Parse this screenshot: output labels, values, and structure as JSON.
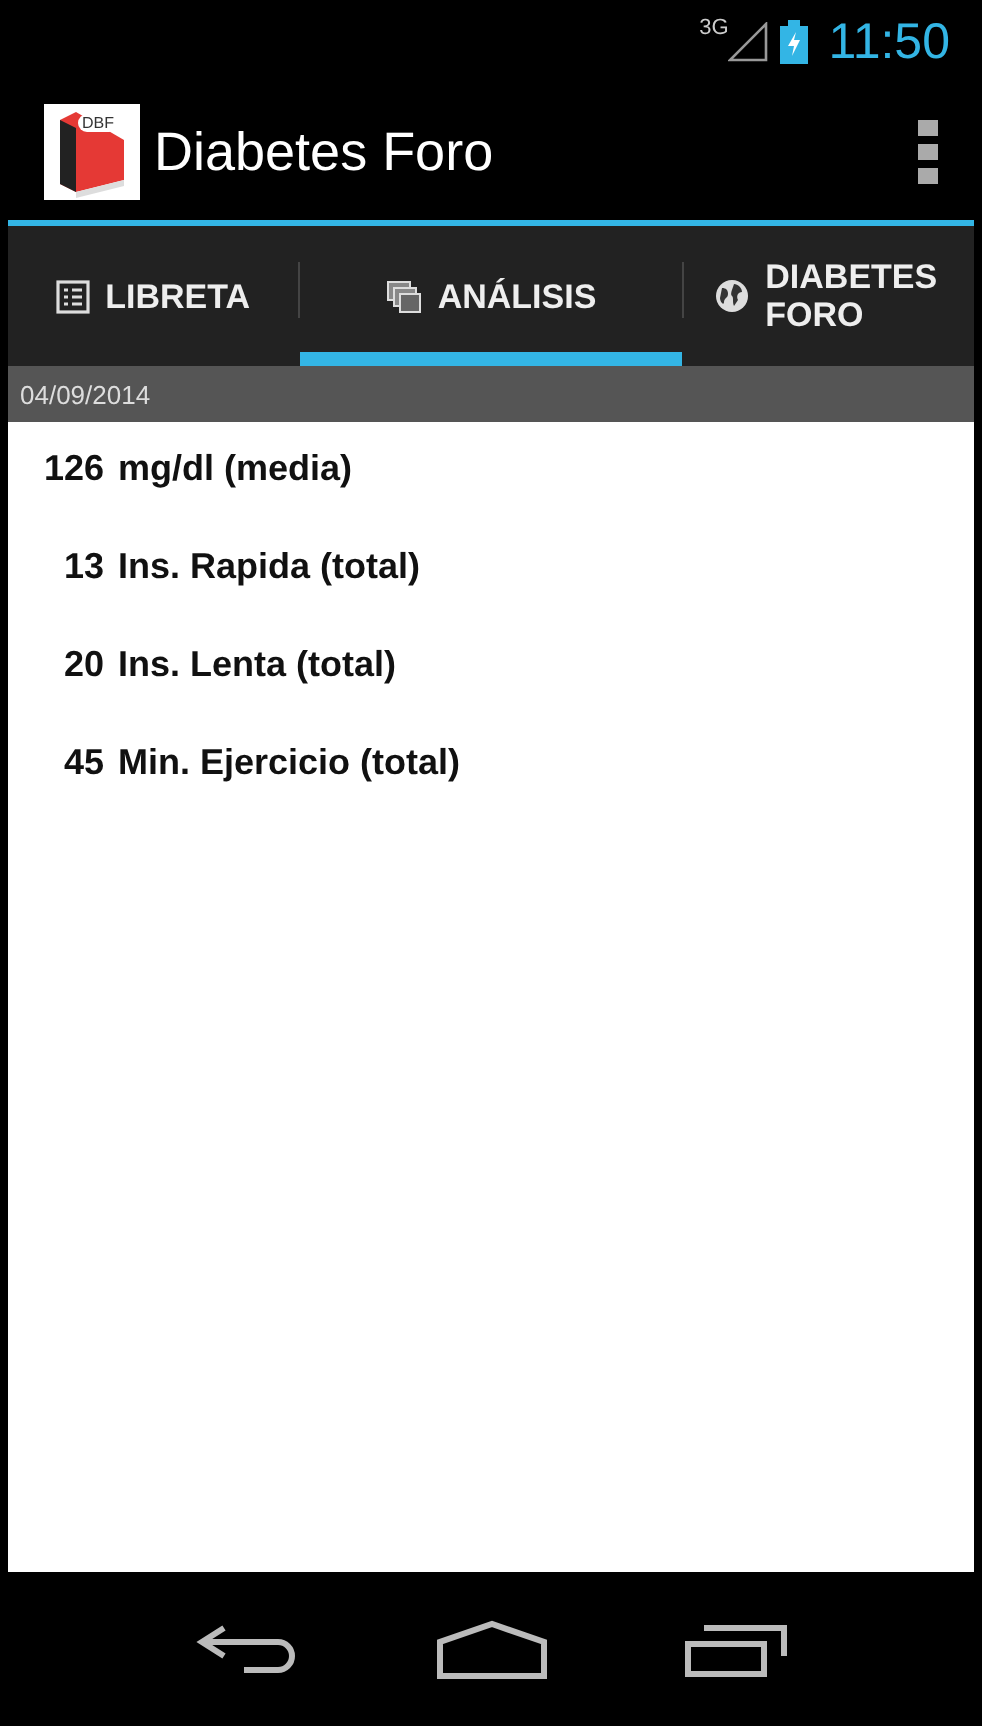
{
  "status_bar": {
    "network": "3G",
    "time": "11:50"
  },
  "action_bar": {
    "title": "Diabetes Foro",
    "logo_text": "DBF"
  },
  "tabs": [
    {
      "label": "LIBRETA",
      "kind": "list",
      "selected": false
    },
    {
      "label": "ANÁLISIS",
      "kind": "windows",
      "selected": true
    },
    {
      "label": "DIABETES FORO",
      "kind": "globe",
      "selected": false
    }
  ],
  "date_header": "04/09/2014",
  "stats": [
    {
      "value": "126",
      "label": "mg/dl (media)"
    },
    {
      "value": "13",
      "label": "Ins. Rapida (total)"
    },
    {
      "value": "20",
      "label": "Ins. Lenta (total)"
    },
    {
      "value": "45",
      "label": "Min. Ejercicio (total)"
    }
  ]
}
